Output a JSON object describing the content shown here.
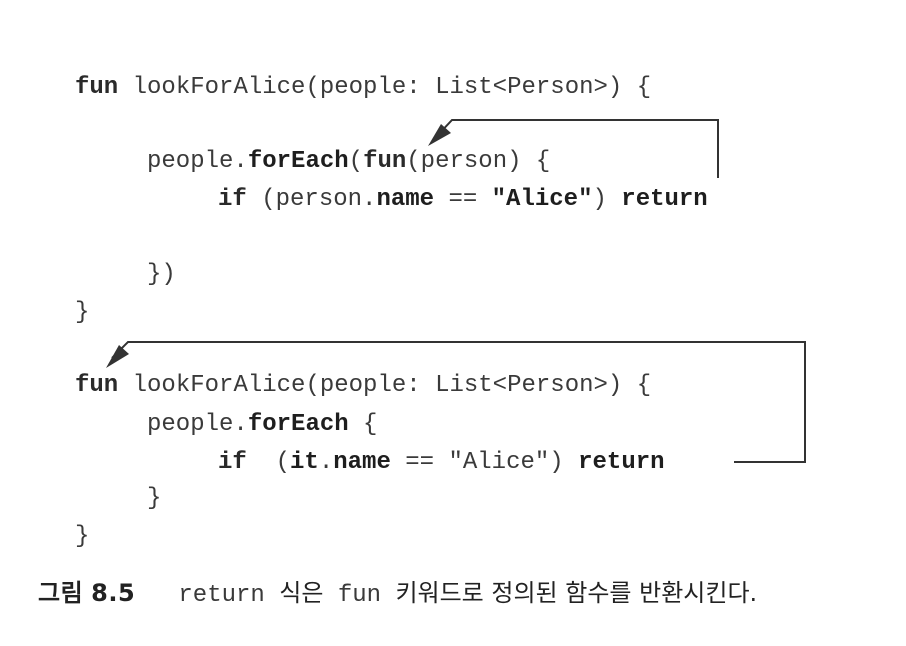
{
  "code_block_1": {
    "line1": {
      "kw": "fun",
      "rest": " lookForAlice(people: List<Person>) {"
    },
    "line2": {
      "pre": "people.",
      "fn": "forEach",
      "open": "(",
      "kw": "fun",
      "rest": "(person) {"
    },
    "line3": {
      "kw": "if",
      "pre": " (person.",
      "prop": "name",
      "op": " == ",
      "str": "\"Alice\"",
      "close": ")",
      "ret": " return"
    },
    "line4": "})",
    "line5": "}"
  },
  "code_block_2": {
    "line1": {
      "kw": "fun",
      "rest": " lookForAlice(people: List<Person>) {"
    },
    "line2": {
      "pre": "people.",
      "fn": "forEach",
      "rest": " {"
    },
    "line3": {
      "kw": "if",
      "pre": "  (",
      "it": "it",
      "dot": ".",
      "prop": "name",
      "op": " == ",
      "str": "\"Alice\"",
      "close": ")",
      "ret": " return"
    },
    "line4": "}",
    "line5": "}"
  },
  "caption": {
    "label": "그림",
    "number": "8.5",
    "keyword_return": "return",
    "text1": "식은",
    "keyword_fun": "fun",
    "text2": "키워드로 정의된 함수를 반환시킨다."
  },
  "colors": {
    "text": "#333333",
    "arrow": "#333333",
    "background": "#ffffff"
  }
}
